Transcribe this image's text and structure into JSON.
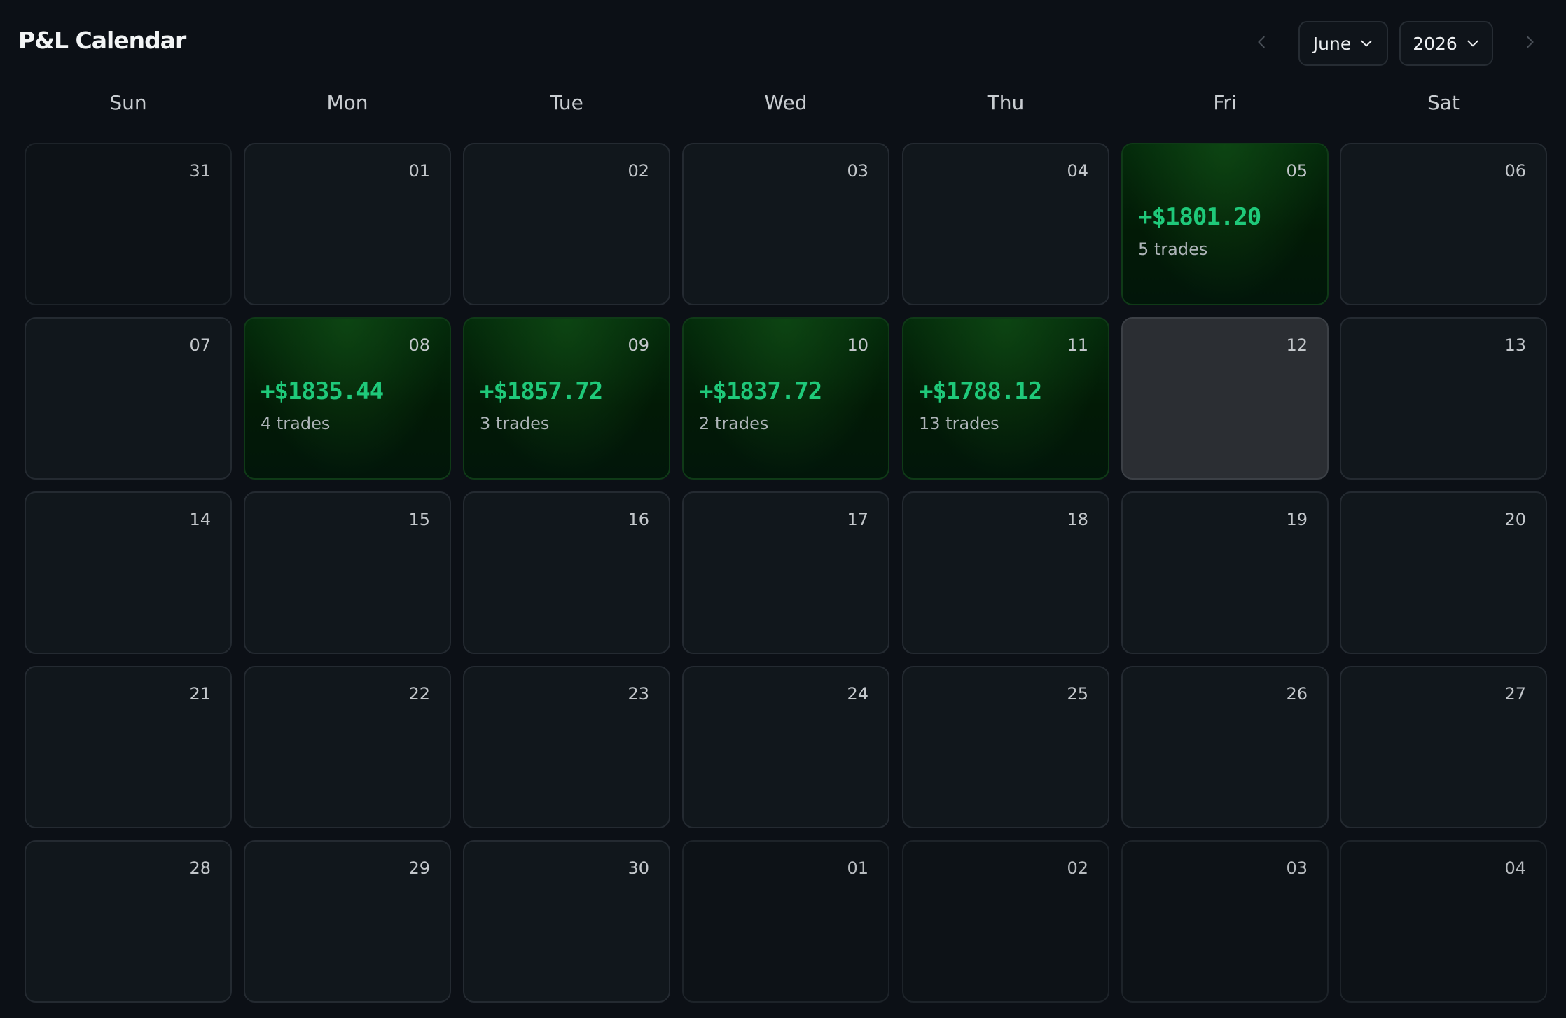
{
  "header": {
    "title": "P&L Calendar",
    "month": "June",
    "year": "2026",
    "prev_icon": "chevron-left-icon",
    "next_icon": "chevron-right-icon"
  },
  "weekdays": [
    "Sun",
    "Mon",
    "Tue",
    "Wed",
    "Thu",
    "Fri",
    "Sat"
  ],
  "colors": {
    "background": "#0c1016",
    "profit_text": "#1fc97a",
    "profit_cell": "#042b0b",
    "selected_cell": "#2b2e33"
  },
  "weeks": [
    [
      {
        "day": "31",
        "outside": true
      },
      {
        "day": "01"
      },
      {
        "day": "02"
      },
      {
        "day": "03"
      },
      {
        "day": "04"
      },
      {
        "day": "05",
        "pnl": "+$1801.20",
        "trades": "5 trades"
      },
      {
        "day": "06"
      }
    ],
    [
      {
        "day": "07"
      },
      {
        "day": "08",
        "pnl": "+$1835.44",
        "trades": "4 trades"
      },
      {
        "day": "09",
        "pnl": "+$1857.72",
        "trades": "3 trades"
      },
      {
        "day": "10",
        "pnl": "+$1837.72",
        "trades": "2 trades"
      },
      {
        "day": "11",
        "pnl": "+$1788.12",
        "trades": "13 trades"
      },
      {
        "day": "12",
        "selected": true
      },
      {
        "day": "13"
      }
    ],
    [
      {
        "day": "14"
      },
      {
        "day": "15"
      },
      {
        "day": "16"
      },
      {
        "day": "17"
      },
      {
        "day": "18"
      },
      {
        "day": "19"
      },
      {
        "day": "20"
      }
    ],
    [
      {
        "day": "21"
      },
      {
        "day": "22"
      },
      {
        "day": "23"
      },
      {
        "day": "24"
      },
      {
        "day": "25"
      },
      {
        "day": "26"
      },
      {
        "day": "27"
      }
    ],
    [
      {
        "day": "28"
      },
      {
        "day": "29"
      },
      {
        "day": "30"
      },
      {
        "day": "01",
        "outside": true
      },
      {
        "day": "02",
        "outside": true
      },
      {
        "day": "03",
        "outside": true
      },
      {
        "day": "04",
        "outside": true
      }
    ]
  ]
}
